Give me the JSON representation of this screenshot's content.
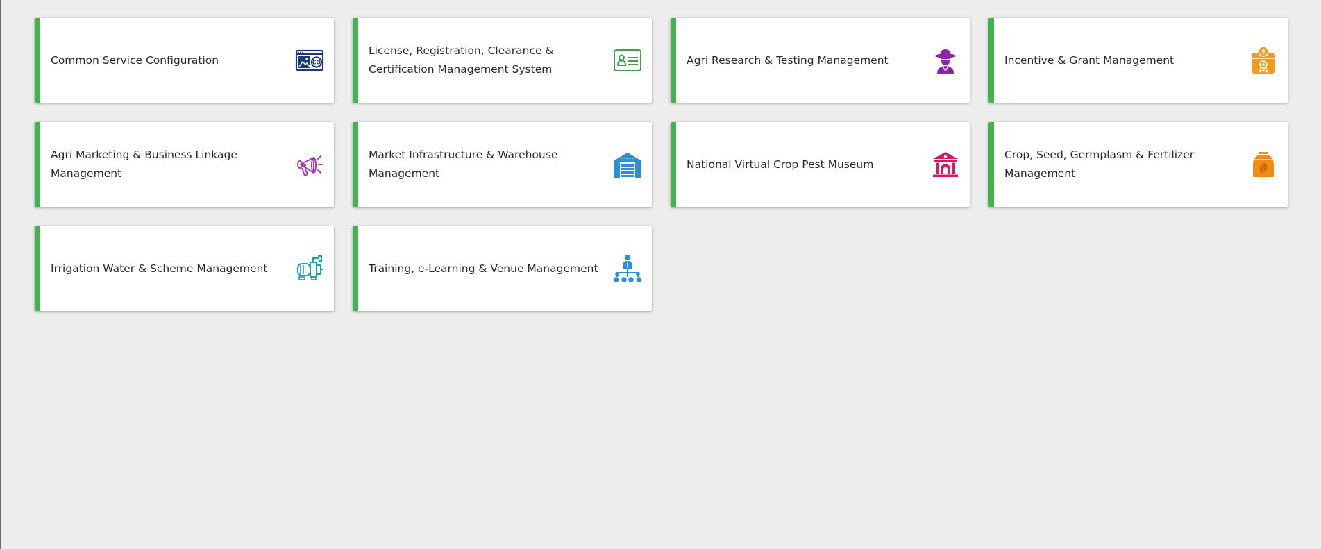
{
  "modules": [
    {
      "title": "Common Service Configuration",
      "icon": "config-card-icon",
      "color": "#1b3a73"
    },
    {
      "title": "License, Registration, Clearance & Certification Management System",
      "icon": "id-card-icon",
      "color": "#3fa34d"
    },
    {
      "title": "Agri Research & Testing Management",
      "icon": "farmer-icon",
      "color": "#8e24aa"
    },
    {
      "title": "Incentive & Grant Management",
      "icon": "grant-money-icon",
      "color": "#f59a1b"
    },
    {
      "title": "Agri Marketing & Business Linkage Management",
      "icon": "megaphone-icon",
      "color": "#a53bb0"
    },
    {
      "title": "Market Infrastructure & Warehouse Management",
      "icon": "warehouse-icon",
      "color": "#2a8fd8"
    },
    {
      "title": "National Virtual Crop Pest Museum",
      "icon": "museum-icon",
      "color": "#d81b60"
    },
    {
      "title": "Crop, Seed, Germplasm & Fertilizer Management",
      "icon": "seed-bag-icon",
      "color": "#f28c12"
    },
    {
      "title": "Irrigation Water & Scheme Management",
      "icon": "water-pump-icon",
      "color": "#12a5b5"
    },
    {
      "title": "Training, e-Learning & Venue Management",
      "icon": "training-hierarchy-icon",
      "color": "#2a8fd8"
    }
  ],
  "theme": {
    "accent": "#3fb54b",
    "background": "#ededed"
  }
}
